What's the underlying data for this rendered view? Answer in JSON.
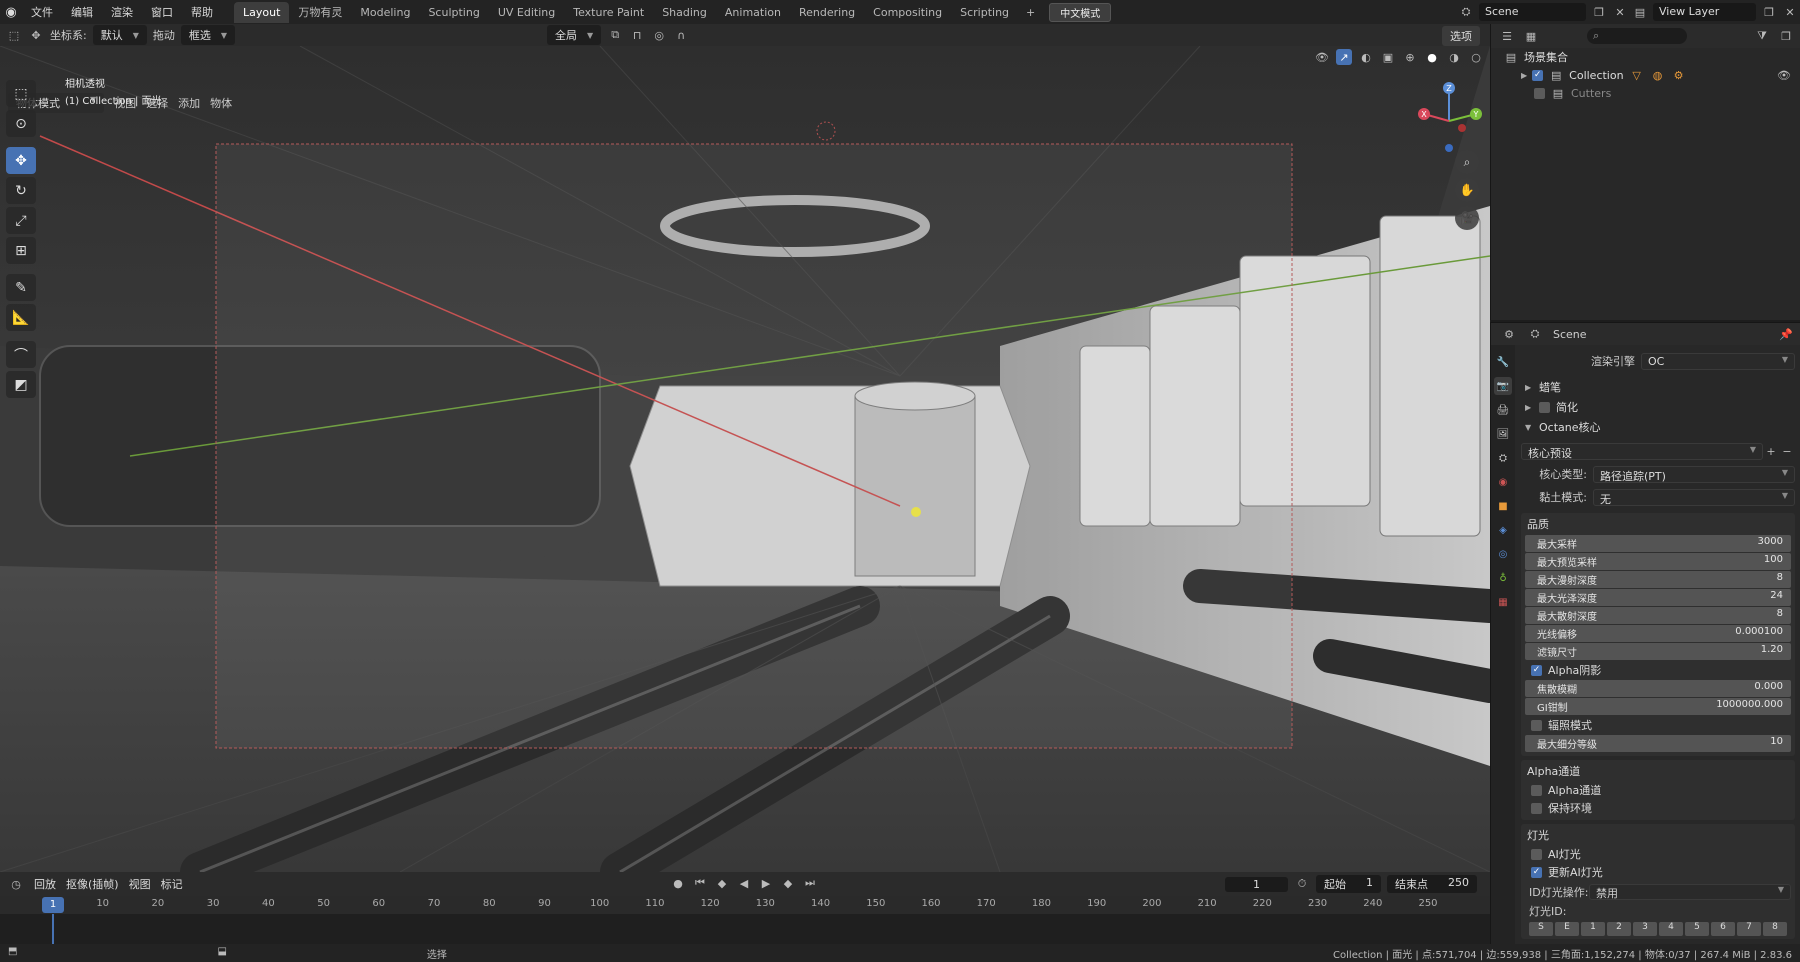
{
  "menu": [
    "文件",
    "编辑",
    "渲染",
    "窗口",
    "帮助"
  ],
  "workspaces": [
    "Layout",
    "万物有灵",
    "Modeling",
    "Sculpting",
    "UV Editing",
    "Texture Paint",
    "Shading",
    "Animation",
    "Rendering",
    "Compositing",
    "Scripting"
  ],
  "active_workspace": "Layout",
  "cn_mode": "中文模式",
  "scene_name": "Scene",
  "view_layer": "View Layer",
  "toolheader": {
    "coord_label": "坐标系:",
    "coord_value": "默认",
    "drag_label": "拖动",
    "drag_value": "框选",
    "pivot_value": "全局",
    "options": "选项"
  },
  "vpheader": {
    "mode": "物体模式",
    "menus": [
      "视图",
      "选择",
      "添加",
      "物体"
    ]
  },
  "viewport_info": {
    "line1": "相机透视",
    "line2": "(1) Collection | 面光"
  },
  "gizmo": {
    "x": "X",
    "y": "Y",
    "z": "Z"
  },
  "timeline": {
    "menus": [
      "回放",
      "抠像(插帧)",
      "视图",
      "标记"
    ],
    "current_frame": "1",
    "start_label": "起始",
    "start": "1",
    "end_label": "结束点",
    "end": "250",
    "ticks": [
      "1",
      "10",
      "20",
      "30",
      "40",
      "50",
      "60",
      "70",
      "80",
      "90",
      "100",
      "110",
      "120",
      "130",
      "140",
      "150",
      "160",
      "170",
      "180",
      "190",
      "200",
      "210",
      "220",
      "230",
      "240",
      "250"
    ]
  },
  "statusbar": {
    "select": "选择",
    "info": "Collection | 面光 | 点:571,704 | 边:559,938 | 三角面:1,152,274 | 物体:0/37 | 267.4 MiB | 2.83.6"
  },
  "outliner": {
    "root": "场景集合",
    "collection": "Collection",
    "cutters": "Cutters"
  },
  "props": {
    "header": "Scene",
    "render_engine_label": "渲染引擎",
    "render_engine": "OC",
    "panel_grease": "蜡笔",
    "panel_simplify": "简化",
    "panel_octane": "Octane核心",
    "kernel_preset": "核心预设",
    "kernel_type_label": "核心类型:",
    "kernel_type": "路径追踪(PT)",
    "clay_label": "黏土模式:",
    "clay": "无",
    "quality_title": "品质",
    "quality": [
      {
        "label": "最大采样",
        "value": "3000"
      },
      {
        "label": "最大预览采样",
        "value": "100"
      },
      {
        "label": "最大漫射深度",
        "value": "8"
      },
      {
        "label": "最大光泽深度",
        "value": "24"
      },
      {
        "label": "最大散射深度",
        "value": "8"
      },
      {
        "label": "光线偏移",
        "value": "0.000100"
      },
      {
        "label": "滤镜尺寸",
        "value": "1.20"
      }
    ],
    "alpha_shadow": "Alpha阴影",
    "quality2": [
      {
        "label": "焦散模糊",
        "value": "0.000"
      },
      {
        "label": "GI钳制",
        "value": "1000000.000"
      }
    ],
    "irradiance": "辐照模式",
    "max_subdiv_label": "最大细分等级",
    "max_subdiv": "10",
    "alpha_channel_title": "Alpha通道",
    "alpha_channel": "Alpha通道",
    "keep_env": "保持环境",
    "light_title": "灯光",
    "ai_light": "AI灯光",
    "ai_update": "更新AI灯光",
    "id_op_label": "ID灯光操作:",
    "id_op": "禁用",
    "light_id_label": "灯光ID:",
    "light_bits": [
      "S",
      "E",
      "1",
      "2",
      "3",
      "4",
      "5",
      "6",
      "7",
      "8"
    ]
  },
  "colors": {
    "accent": "#4772b3",
    "bg": "#232323"
  }
}
